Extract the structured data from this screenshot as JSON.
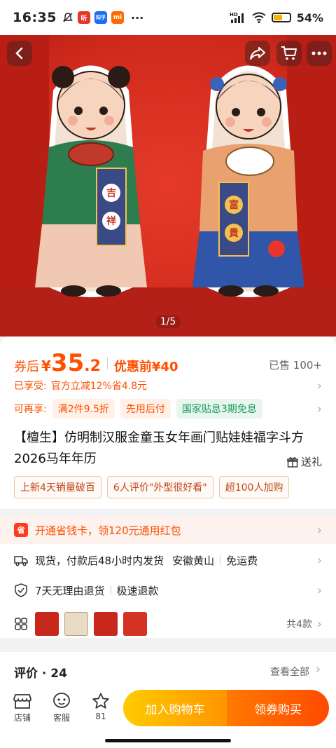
{
  "status_bar": {
    "time": "16:35",
    "app_icons": [
      "mute-icon",
      "听",
      "知乎",
      "mi"
    ],
    "network": "HD",
    "battery_percent": "54%",
    "battery_level": 0.54
  },
  "gallery": {
    "page_indicator": "1/5",
    "left_badge_chars": [
      "吉",
      "祥"
    ],
    "right_badge_chars": [
      "富",
      "貴"
    ]
  },
  "price": {
    "prefix": "券后",
    "currency": "¥",
    "integer": "35",
    "decimal": ".2",
    "before_discount": "优惠前¥40",
    "sold": "已售 100+"
  },
  "enjoyed": {
    "label": "已享受:",
    "text": "官方立减12%省4.8元"
  },
  "available": {
    "label": "可再享:",
    "pills": [
      "满2件9.5折",
      "先用后付",
      "国家贴息3期免息"
    ]
  },
  "product": {
    "title": "【檀生】仿明制汉服金童玉女年画门贴娃娃福字斗方2026马年年历",
    "gift_label": "送礼"
  },
  "tags": [
    "上新4天销量破百",
    "6人评价\"外型很好看\"",
    "超100人加购"
  ],
  "coupon": {
    "icon_text": "省",
    "text": "开通省钱卡，领120元通用红包"
  },
  "shipping": {
    "text": "现货，付款后48小时内发货",
    "location": "安徽黄山",
    "fee": "免运费"
  },
  "returns": {
    "text": "7天无理由退货",
    "refund": "极速退款"
  },
  "variants": {
    "count_text": "共4款"
  },
  "reviews": {
    "title": "评价 · 24",
    "view_all": "查看全部"
  },
  "bottom_nav": {
    "store": "店铺",
    "service": "客服",
    "favorites": "81",
    "add_to_cart": "加入购物车",
    "buy": "领券购买"
  },
  "colors": {
    "accent": "#ff5000",
    "green_pill": "#1a9a5a"
  }
}
